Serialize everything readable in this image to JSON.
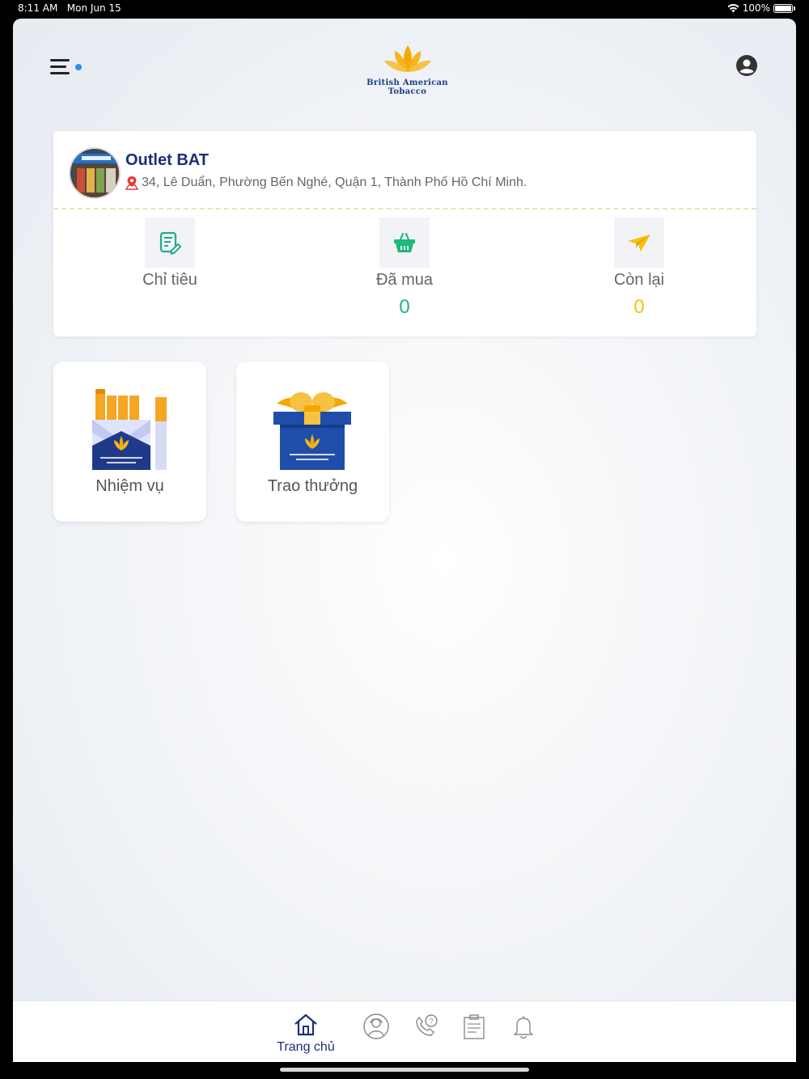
{
  "status_bar": {
    "time": "8:11 AM",
    "date": "Mon Jun 15",
    "battery_percent": "100%"
  },
  "header": {
    "menu_icon": "hamburger-menu-icon",
    "logo_line1": "British American",
    "logo_line2": "Tobacco",
    "profile_icon": "account-circle-icon"
  },
  "outlet": {
    "name": "Outlet BAT",
    "address": "34, Lê Duẩn, Phường Bến Nghé, Quận 1, Thành Phố Hồ Chí Minh.",
    "stats": [
      {
        "label": "Chỉ tiêu",
        "value": "",
        "icon": "target-notepad-icon",
        "color": "#23a98a"
      },
      {
        "label": "Đã mua",
        "value": "0",
        "icon": "basket-icon",
        "color": "#1fb77a"
      },
      {
        "label": "Còn lại",
        "value": "0",
        "icon": "paper-plane-icon",
        "color": "#f4c20d"
      }
    ]
  },
  "tiles": [
    {
      "label": "Nhiệm vụ",
      "icon": "cigarette-pack-icon"
    },
    {
      "label": "Trao thưởng",
      "icon": "gift-box-icon"
    }
  ],
  "bottom_nav": {
    "active_label": "Trang chủ",
    "items": [
      "home-icon",
      "support-agent-icon",
      "phone-help-icon",
      "clipboard-icon",
      "bell-icon"
    ]
  },
  "colors": {
    "brand_navy": "#1b2f78",
    "brand_gold": "#f2a900",
    "accent_blue": "#2f8de4"
  }
}
